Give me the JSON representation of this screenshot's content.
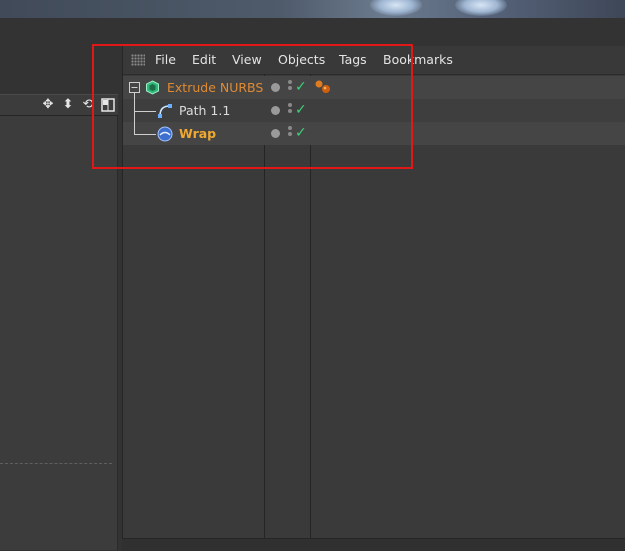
{
  "menu": {
    "file": "File",
    "edit": "Edit",
    "view": "View",
    "objects": "Objects",
    "tags": "Tags",
    "bookmarks": "Bookmarks"
  },
  "objects": [
    {
      "name": "Extrude NURBS",
      "icon": "extrude-nurbs-icon",
      "color": "#e08a32"
    },
    {
      "name": "Path 1.1",
      "icon": "spline-path-icon",
      "color": "#dcdcdc"
    },
    {
      "name": "Wrap",
      "icon": "wrap-deformer-icon",
      "color": "#f0a830"
    }
  ],
  "viewport_toolbar_icons": [
    "move-icon",
    "up-down-arrow-icon",
    "rotate-icon",
    "layout-icon"
  ],
  "annotation_color": "#e01818"
}
